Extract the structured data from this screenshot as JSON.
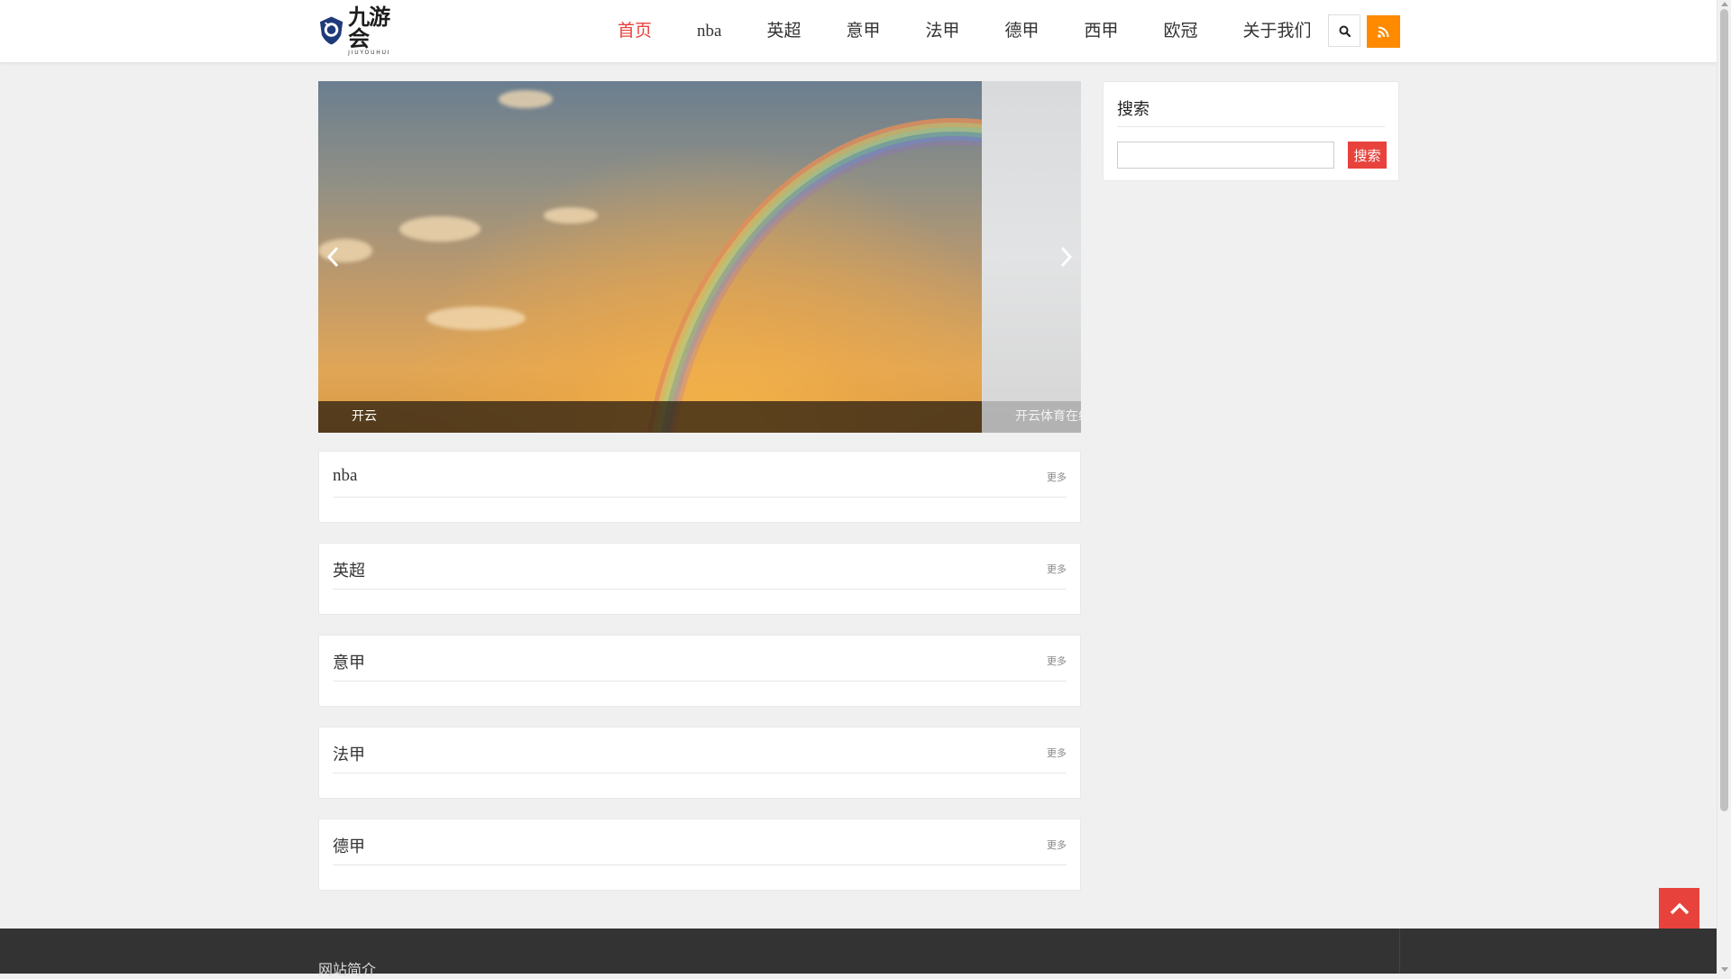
{
  "header": {
    "logo": {
      "cn": "九游会",
      "en": "JIUYOUHUI"
    },
    "nav": [
      {
        "label": "首页",
        "active": true
      },
      {
        "label": "nba",
        "active": false
      },
      {
        "label": "英超",
        "active": false
      },
      {
        "label": "意甲",
        "active": false
      },
      {
        "label": "法甲",
        "active": false
      },
      {
        "label": "德甲",
        "active": false
      },
      {
        "label": "西甲",
        "active": false
      },
      {
        "label": "欧冠",
        "active": false
      },
      {
        "label": "关于我们",
        "active": false
      }
    ],
    "search_icon": "search-icon",
    "rss_icon": "rss-icon"
  },
  "slider": {
    "slides": [
      {
        "caption": "开云"
      },
      {
        "caption": "开云体育在线"
      }
    ]
  },
  "sections": [
    {
      "title": "nba",
      "more": "更多"
    },
    {
      "title": "英超",
      "more": "更多"
    },
    {
      "title": "意甲",
      "more": "更多"
    },
    {
      "title": "法甲",
      "more": "更多"
    },
    {
      "title": "德甲",
      "more": "更多"
    }
  ],
  "sidebar": {
    "search_widget": {
      "title": "搜索",
      "input_value": "",
      "button_label": "搜索"
    }
  },
  "footer": {
    "title": "网站简介"
  },
  "colors": {
    "accent": "#e8423c",
    "rss": "#ff8a00",
    "footer_bg": "#333333"
  }
}
